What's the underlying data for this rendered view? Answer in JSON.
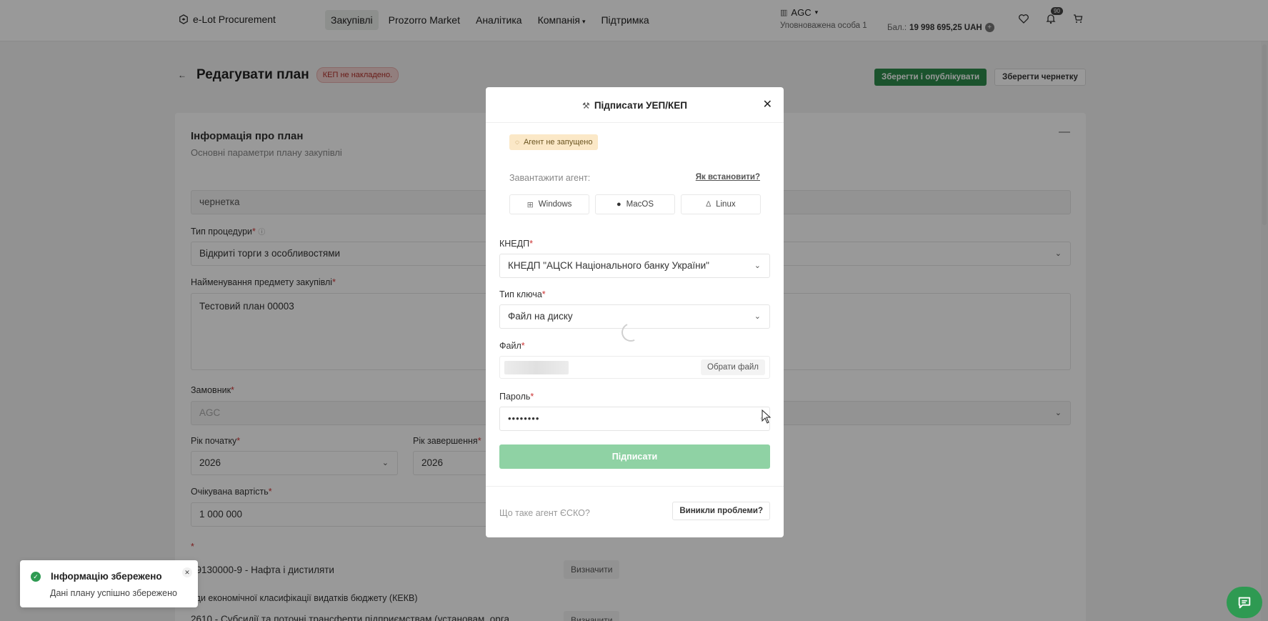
{
  "header": {
    "logo_text": "e-Lot Procurement",
    "nav": [
      {
        "label": "Закупівлі",
        "active": true
      },
      {
        "label": "Prozorro Market"
      },
      {
        "label": "Аналітика"
      },
      {
        "label": "Компанія",
        "has_caret": true
      },
      {
        "label": "Підтримка"
      }
    ],
    "org_name": "AGC",
    "org_sub": "Уповноважена особа 1",
    "balance_label": "Бал.:",
    "balance_value": "19 998 695,25 UAH",
    "notifications_count": "90"
  },
  "page": {
    "title": "Редагувати план",
    "kep_badge": "КЕП не накладено.",
    "publish_button": "Зберегти і опублікувати",
    "draft_button": "Зберегти чернетку",
    "section_title": "Інформація про план",
    "section_subtitle": "Основні параметри плану закупівлі",
    "status_value": "чернетка",
    "procedure_label": "Тип процедури",
    "procedure_value": "Відкриті торги з особливостями",
    "subject_label": "Найменування предмету закупівлі",
    "subject_value": "Тестовий план 00003",
    "customer_label": "Замовник",
    "customer_value": "AGC",
    "start_year_label": "Рік початку",
    "start_year_value": "2026",
    "end_year_label": "Рік завершення",
    "end_year_value": "2026",
    "expected_value_label": "Очікувана вартість",
    "expected_value": "1 000 000",
    "cpv_value": "09130000-9 - Нафта і дистиляти",
    "cpv_button": "Визначити",
    "kekv_label": "оди економічної класифікації видатків бюджету (КЕКВ)",
    "kekv_value": "2610 - Субсидії та поточні трансферти підприємствам (установам, орга",
    "kekv_button": "Визначити",
    "required_mark": "*"
  },
  "modal": {
    "title": "Підписати УЕП/КЕП",
    "agent_warning": "Агент не запущено",
    "download_label": "Завантажити агент:",
    "how_to_install": "Як встановити?",
    "os_buttons": [
      "Windows",
      "MacOS",
      "Linux"
    ],
    "kednp_label": "КНЕДП",
    "kednp_value": "КНЕДП \"АЦСК Національного банку України\"",
    "key_type_label": "Тип ключа",
    "key_type_value": "Файл на диску",
    "file_label": "Файл",
    "choose_file_button": "Обрати файл",
    "password_label": "Пароль",
    "password_value": "••••••••",
    "sign_button": "Підписати",
    "what_is_agent": "Що таке агент ЄСКО?",
    "problems_button": "Виникли проблеми?"
  },
  "toast": {
    "title": "Інформацію збережено",
    "message": "Дані плану успішно збережено"
  },
  "colors": {
    "accent_green": "#2e8a4b",
    "sign_disabled": "#8fd2a4",
    "kep_badge_bg": "#f4d4d2",
    "warning_bg": "#fbe8c7"
  }
}
